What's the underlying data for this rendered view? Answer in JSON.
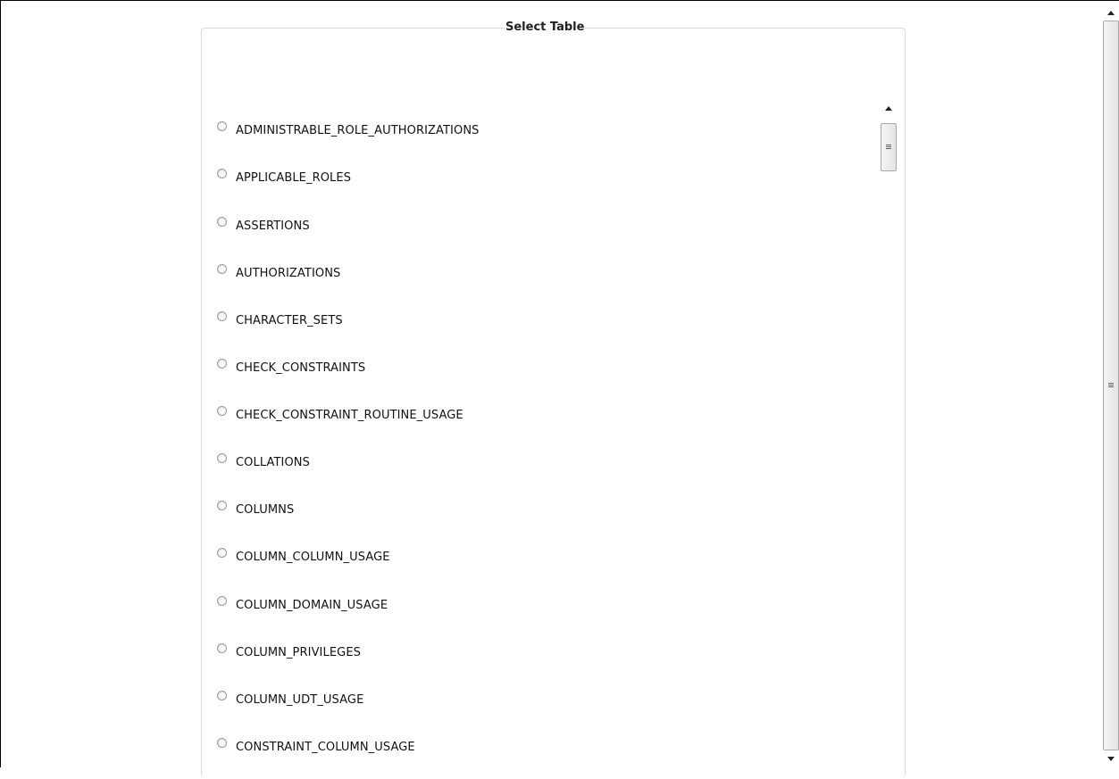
{
  "panel": {
    "legend": "Select Table"
  },
  "tables": [
    "ADMINISTRABLE_ROLE_AUTHORIZATIONS",
    "APPLICABLE_ROLES",
    "ASSERTIONS",
    "AUTHORIZATIONS",
    "CHARACTER_SETS",
    "CHECK_CONSTRAINTS",
    "CHECK_CONSTRAINT_ROUTINE_USAGE",
    "COLLATIONS",
    "COLUMNS",
    "COLUMN_COLUMN_USAGE",
    "COLUMN_DOMAIN_USAGE",
    "COLUMN_PRIVILEGES",
    "COLUMN_UDT_USAGE",
    "CONSTRAINT_COLUMN_USAGE"
  ],
  "icons": {
    "scroll_up": "scroll-up-arrow-icon",
    "scroll_down": "scroll-down-arrow-icon",
    "thumb_grip": "grip-icon"
  }
}
